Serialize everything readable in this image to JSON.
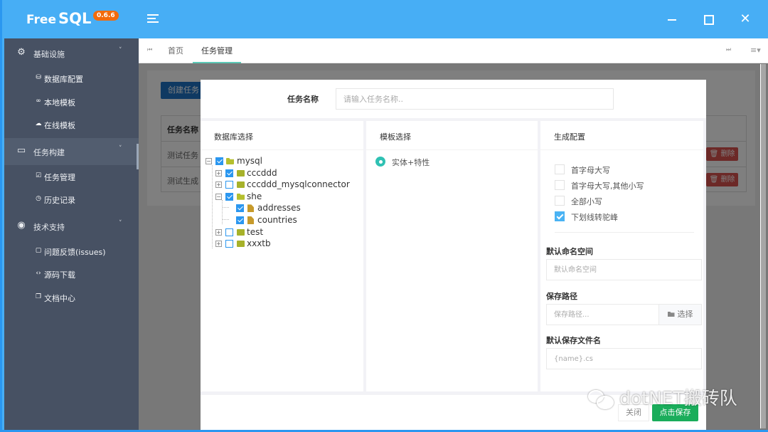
{
  "app": {
    "name_free": "Free",
    "name_sql": "SQL",
    "version": "0.6.6"
  },
  "window_controls": {
    "minimize": "minimize",
    "maximize": "maximize",
    "close": "✕"
  },
  "sidebar": {
    "groups": [
      {
        "label": "基础设施",
        "icon": "gear-icon",
        "items": [
          {
            "label": "数据库配置",
            "icon": "database-icon"
          },
          {
            "label": "本地模板",
            "icon": "link-icon"
          },
          {
            "label": "在线模板",
            "icon": "cloud-icon"
          }
        ]
      },
      {
        "label": "任务构建",
        "icon": "window-icon",
        "active": true,
        "items": [
          {
            "label": "任务管理",
            "icon": "calendar-check-icon"
          },
          {
            "label": "历史记录",
            "icon": "history-icon"
          }
        ]
      },
      {
        "label": "技术支持",
        "icon": "fingerprint-icon",
        "items": [
          {
            "label": "问题反馈(issues)",
            "icon": "comment-icon"
          },
          {
            "label": "源码下载",
            "icon": "code-icon"
          },
          {
            "label": "文档中心",
            "icon": "docs-icon"
          }
        ]
      }
    ]
  },
  "tabs": {
    "items": [
      {
        "label": "首页",
        "active": false
      },
      {
        "label": "任务管理",
        "active": true
      }
    ],
    "nav_left": "⏮",
    "nav_right": "⏭",
    "menu": "≡▾"
  },
  "background_page": {
    "create_button": "创建任务",
    "table_header": "任务名称",
    "rows": [
      {
        "name": "测试任务",
        "delete": "删除"
      },
      {
        "name": "测试生成",
        "delete": "删除"
      }
    ]
  },
  "modal": {
    "task_name_label": "任务名称",
    "task_name_placeholder": "请输入任务名称..",
    "db_panel": {
      "title": "数据库选择",
      "tree": [
        {
          "label": "mysql",
          "checked": true,
          "expanded": true,
          "type": "folder",
          "level": 0
        },
        {
          "label": "cccddd",
          "checked": true,
          "expanded": false,
          "type": "folder",
          "level": 1
        },
        {
          "label": "cccddd_mysqlconnector",
          "checked": false,
          "expanded": false,
          "type": "folder",
          "level": 1
        },
        {
          "label": "she",
          "checked": true,
          "expanded": true,
          "type": "folder",
          "level": 1
        },
        {
          "label": "addresses",
          "checked": true,
          "type": "file",
          "level": 2
        },
        {
          "label": "countries",
          "checked": true,
          "type": "file",
          "level": 2
        },
        {
          "label": "test",
          "checked": false,
          "expanded": false,
          "type": "folder",
          "level": 1
        },
        {
          "label": "xxxtb",
          "checked": false,
          "expanded": false,
          "type": "folder",
          "level": 1
        }
      ]
    },
    "template_panel": {
      "title": "模板选择",
      "options": [
        {
          "label": "实体+特性",
          "selected": true
        }
      ]
    },
    "config_panel": {
      "title": "生成配置",
      "options": [
        {
          "label": "首字母大写",
          "checked": false
        },
        {
          "label": "首字母大写,其他小写",
          "checked": false
        },
        {
          "label": "全部小写",
          "checked": false
        },
        {
          "label": "下划线转驼峰",
          "checked": true
        }
      ],
      "namespace_label": "默认命名空间",
      "namespace_placeholder": "默认命名空间",
      "path_label": "保存路径",
      "path_placeholder": "保存路径...",
      "path_button": "选择",
      "filename_label": "默认保存文件名",
      "filename_placeholder": "{name}.cs"
    },
    "close_button": "关闭",
    "save_button": "点击保存"
  },
  "watermark": "dotNET搬砖队",
  "colors": {
    "header": "#47aef5",
    "sidebar": "#475163",
    "save": "#1aad5b",
    "radio": "#2fc1b3",
    "checkbox": "#2b97f0",
    "version_badge": "#f26b0c"
  }
}
